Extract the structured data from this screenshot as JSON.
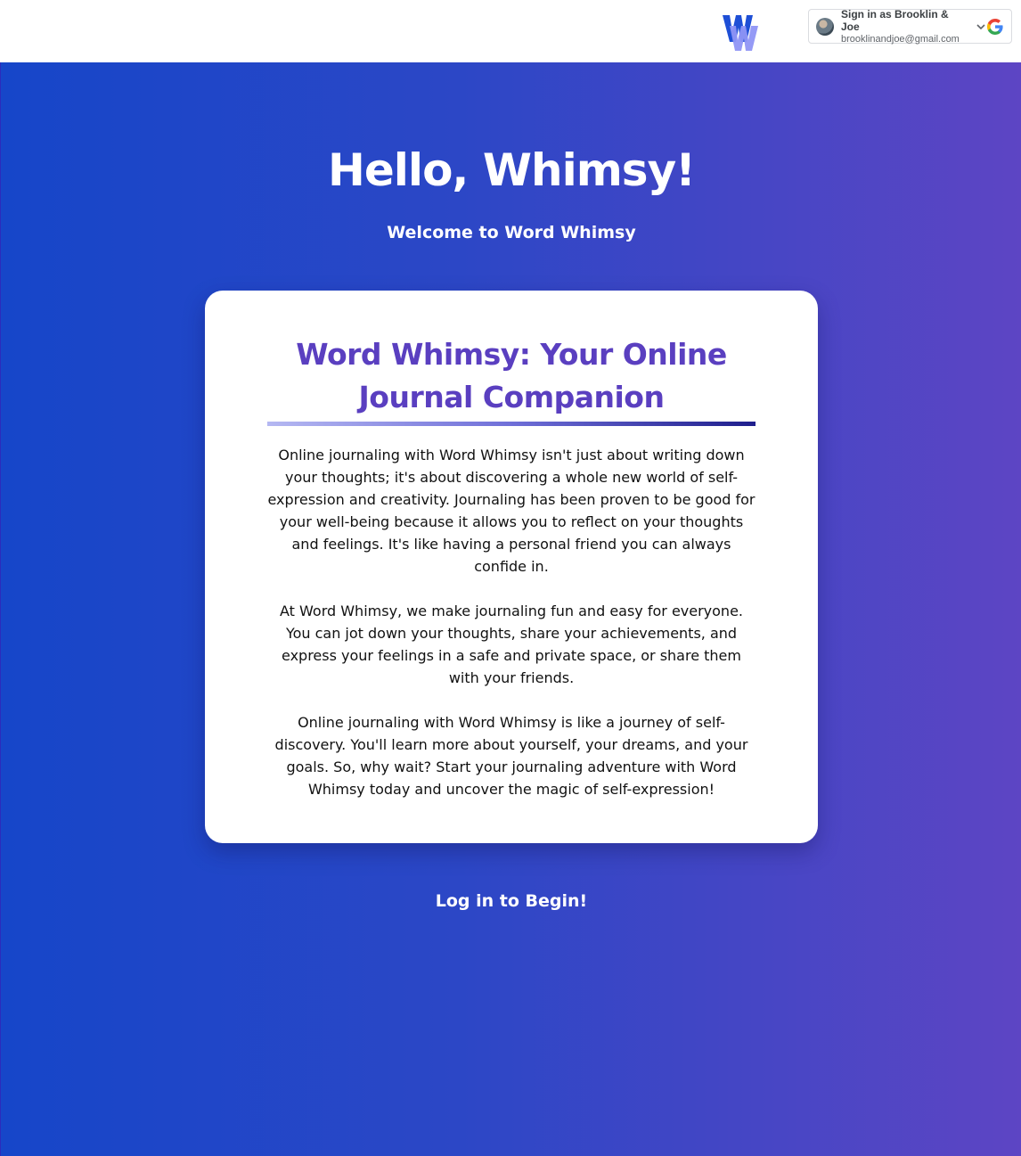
{
  "header": {
    "logo_icon": "word-whimsy-logo",
    "google_signin": {
      "name_line": "Sign in as Brooklin & Joe",
      "email": "brooklinandjoe@gmail.com",
      "avatar_icon": "user-avatar",
      "chevron_icon": "chevron-down-icon",
      "google_icon": "google-g-icon"
    }
  },
  "hero": {
    "title": "Hello, Whimsy!",
    "subtitle": "Welcome to Word Whimsy"
  },
  "card": {
    "title": "Word Whimsy: Your Online Journal Companion",
    "paragraphs": [
      "Online journaling with Word Whimsy isn't just about writing down your thoughts; it's about discovering a whole new world of self-expression and creativity. Journaling has been proven to be good for your well-being because it allows you to reflect on your thoughts and feelings. It's like having a personal friend you can always confide in.",
      "At Word Whimsy, we make journaling fun and easy for everyone. You can jot down your thoughts, share your achievements, and express your feelings in a safe and private space, or share them with your friends.",
      "Online journaling with Word Whimsy is like a journey of self-discovery. You'll learn more about yourself, your dreams, and your goals. So, why wait? Start your journaling adventure with Word Whimsy today and uncover the magic of self-expression!"
    ]
  },
  "cta": {
    "login_label": "Log in to Begin!"
  },
  "colors": {
    "gradient_start": "#1646c9",
    "gradient_end": "#5d45c4",
    "card_title": "#5a3fc0",
    "white": "#ffffff"
  }
}
